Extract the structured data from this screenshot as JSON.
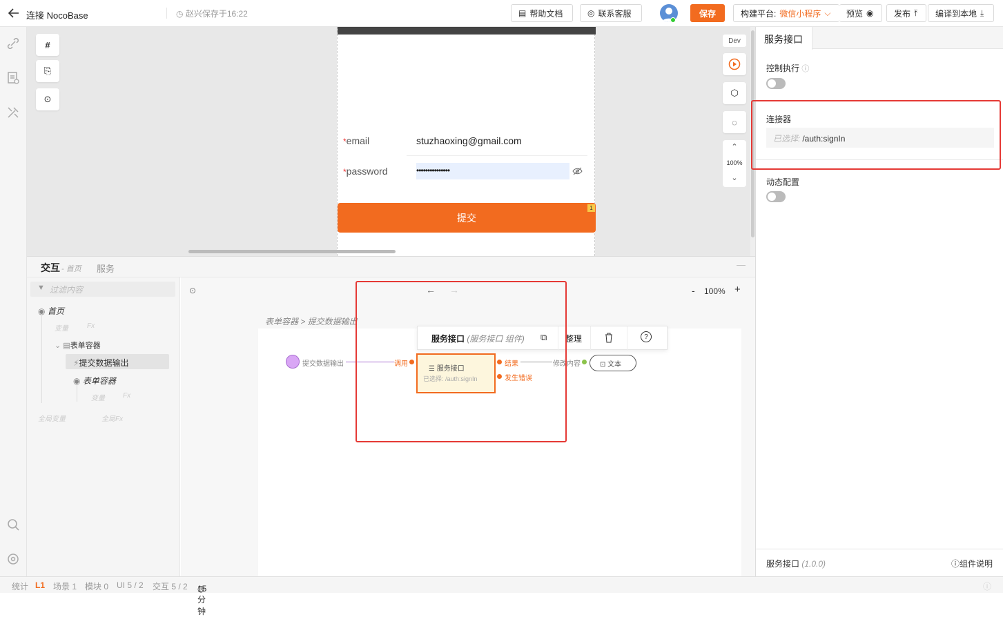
{
  "header": {
    "title": "连接 NocoBase",
    "saved_text": "赵兴保存于16:22",
    "help_label": "帮助文档",
    "support_label": "联系客服",
    "save_label": "保存",
    "platform_prefix": "构建平台:",
    "platform_value": "微信小程序",
    "preview_label": "预览",
    "publish_label": "发布",
    "compile_label": "编译到本地"
  },
  "canvas": {
    "tool_hash": "#",
    "dev_label": "Dev",
    "zoom": "100%",
    "email_label": "email",
    "email_value": "stuzhaoxing@gmail.com",
    "password_label": "password",
    "password_value": "•••••••••••••••",
    "submit_label": "提交",
    "submit_badge": "1",
    "required_mark": "*"
  },
  "bottom": {
    "tab_interaction": "交互",
    "tab_interaction_sub": "- 首页",
    "tab_service": "服务",
    "filter_placeholder": "过滤内容",
    "tree": {
      "home": "首页",
      "var": "变量",
      "fx": "Fx",
      "form_container": "表单容器",
      "submit_output": "提交数据输出",
      "form_container2": "表单容器",
      "var2": "变量",
      "fx2": "Fx",
      "global_var": "全局变量",
      "global_fx": "全局Fx"
    },
    "flow": {
      "zoom": "100%",
      "breadcrumb": "表单容器 > 提交数据输出",
      "toolbar_title": "服务接口",
      "toolbar_sub": "(服务接口 组件)",
      "toolbar_arrange": "整理",
      "start_node": "提交数据输出",
      "call_label": "调用",
      "node_title": "服务接口",
      "node_sub": "已选择: /auth:signIn",
      "result_label": "结果",
      "error_label": "发生错误",
      "modify_label": "修改内容",
      "text_node": "文本"
    }
  },
  "right": {
    "tab": "服务接口",
    "control_exec": "控制执行",
    "connector": "连接器",
    "selected_prefix": "已选择:",
    "selected_value": "/auth:signIn",
    "dynamic_config": "动态配置",
    "footer_name": "服务接口",
    "footer_version": "(1.0.0)",
    "footer_doc": "组件说明"
  },
  "status": {
    "stats": "统计",
    "level": "L1",
    "scene": "场景 1",
    "module": "模块 0",
    "ui": "UI 5 / 2",
    "interaction": "交互 5 / 2",
    "time": "15分钟"
  },
  "colors": {
    "accent": "#f26b1f",
    "highlight_box": "#e53935",
    "start_node": "#d9a6f5"
  }
}
